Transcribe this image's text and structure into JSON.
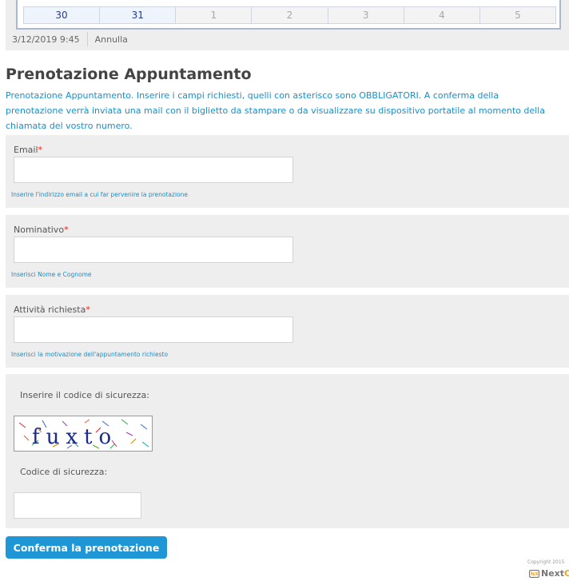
{
  "calendar": {
    "days": [
      {
        "label": "30",
        "state": "current"
      },
      {
        "label": "31",
        "state": "current"
      },
      {
        "label": "1",
        "state": "other"
      },
      {
        "label": "2",
        "state": "other"
      },
      {
        "label": "3",
        "state": "other"
      },
      {
        "label": "4",
        "state": "other"
      },
      {
        "label": "5",
        "state": "other"
      }
    ],
    "selected_datetime": "3/12/2019 9:45",
    "cancel_label": "Annulla"
  },
  "form": {
    "title": "Prenotazione Appuntamento",
    "intro_lines": [
      "Prenotazione Appuntamento. Inserire i campi richiesti, quelli con asterisco sono OBBLIGATORI. A conferma della",
      "prenotazione verrà inviata una mail con il biglietto da stampare o da visualizzare su dispositivo portatile al momento della",
      "chiamata del vostro numero."
    ],
    "required_marker": "*",
    "fields": {
      "email": {
        "label": "Email",
        "value": "",
        "hint": "Inserire l'indirizzo email a cui far pervenire la prenotazione"
      },
      "name": {
        "label": "Nominativo",
        "value": "",
        "hint": "Inserisci Nome e Cognome"
      },
      "activity": {
        "label": "Attività richiesta",
        "value": "",
        "hint": "Inserisci la motivazione dell'appuntamento richiesto"
      }
    },
    "captcha": {
      "prompt": "Inserire il codice di sicurezza:",
      "image_text": "fuxto",
      "code_label": "Codice di sicurezza:",
      "value": ""
    },
    "submit_label": "Conferma la prenotazione"
  },
  "footer": {
    "copyright": "Copyright 2015",
    "brand_prefix": "Next",
    "brand_accent": "C"
  },
  "colors": {
    "accent": "#1f97d7",
    "required": "#e0281e",
    "panel": "#eeeeee"
  }
}
